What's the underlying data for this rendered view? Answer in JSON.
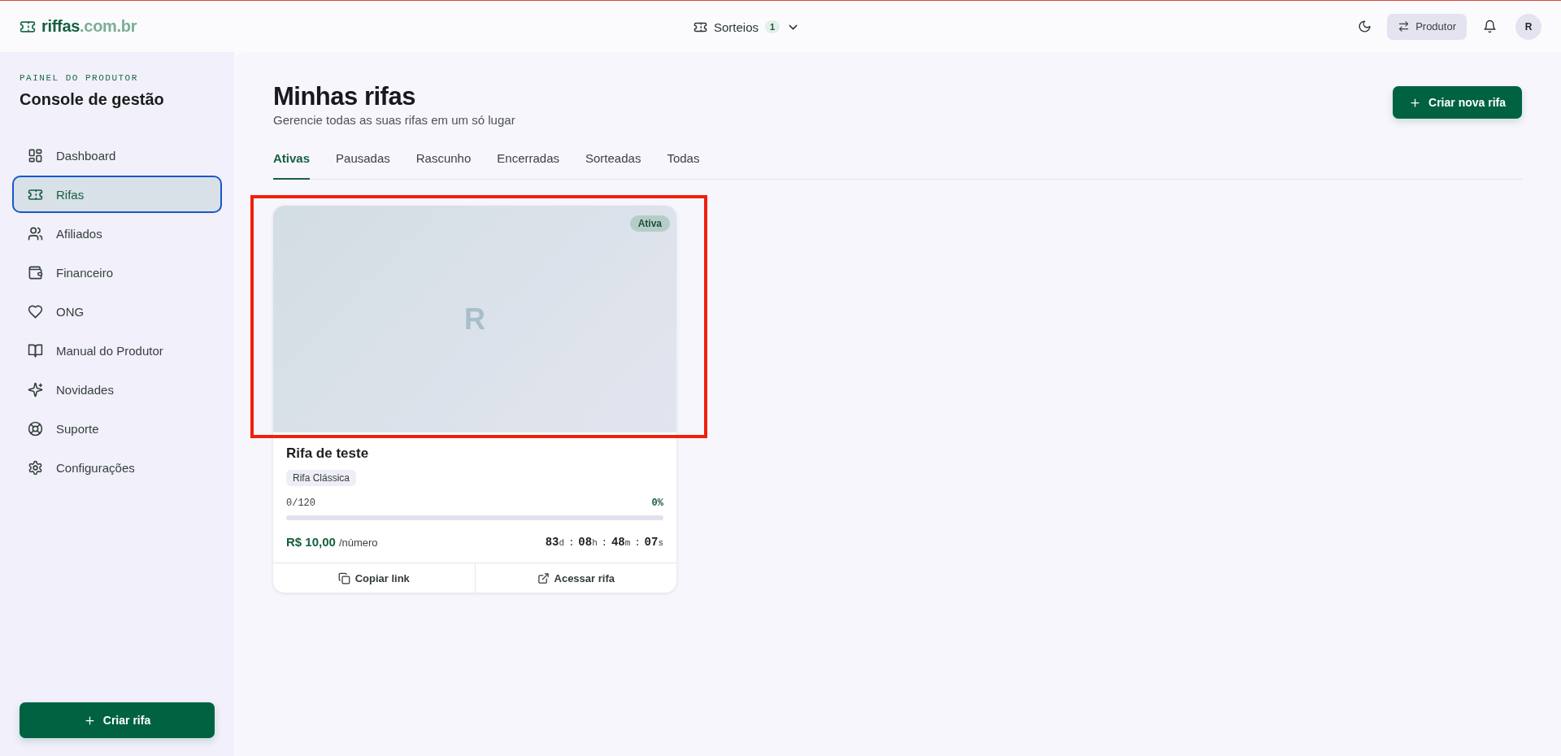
{
  "header": {
    "logo": {
      "name": "riffas",
      "domain": ".com.br"
    },
    "menu": {
      "label": "Sorteios",
      "count": "1"
    },
    "role_button": "Produtor",
    "avatar": "R"
  },
  "sidebar": {
    "eyebrow": "PAINEL DO PRODUTOR",
    "title": "Console de gestão",
    "items": [
      {
        "label": "Dashboard",
        "selected": false
      },
      {
        "label": "Rifas",
        "selected": true
      },
      {
        "label": "Afiliados",
        "selected": false
      },
      {
        "label": "Financeiro",
        "selected": false
      },
      {
        "label": "ONG",
        "selected": false
      },
      {
        "label": "Manual do Produtor",
        "selected": false
      },
      {
        "label": "Novidades",
        "selected": false
      },
      {
        "label": "Suporte",
        "selected": false
      },
      {
        "label": "Configurações",
        "selected": false
      }
    ],
    "create_button": "Criar rifa"
  },
  "page": {
    "title": "Minhas rifas",
    "subtitle": "Gerencie todas as suas rifas em um só lugar",
    "create_button": "Criar nova rifa"
  },
  "tabs": [
    {
      "label": "Ativas",
      "selected": true
    },
    {
      "label": "Pausadas",
      "selected": false
    },
    {
      "label": "Rascunho",
      "selected": false
    },
    {
      "label": "Encerradas",
      "selected": false
    },
    {
      "label": "Sorteadas",
      "selected": false
    },
    {
      "label": "Todas",
      "selected": false
    }
  ],
  "cards": [
    {
      "image_letter": "R",
      "status": "Ativa",
      "title": "Rifa de teste",
      "tag": "Rifa Clássica",
      "sold": "0/120",
      "percent": "0%",
      "level": 0,
      "price": "R$ 10,00",
      "price_unit": "/número",
      "countdown": {
        "separator": ":",
        "parts": [
          {
            "value": "83",
            "unit": "d"
          },
          {
            "value": "08",
            "unit": "h"
          },
          {
            "value": "48",
            "unit": "m"
          },
          {
            "value": "07",
            "unit": "s"
          }
        ]
      },
      "actions": [
        {
          "label": "Copiar link"
        },
        {
          "label": "Acessar rifa"
        }
      ],
      "annotation": {
        "kind": "frame"
      }
    }
  ]
}
